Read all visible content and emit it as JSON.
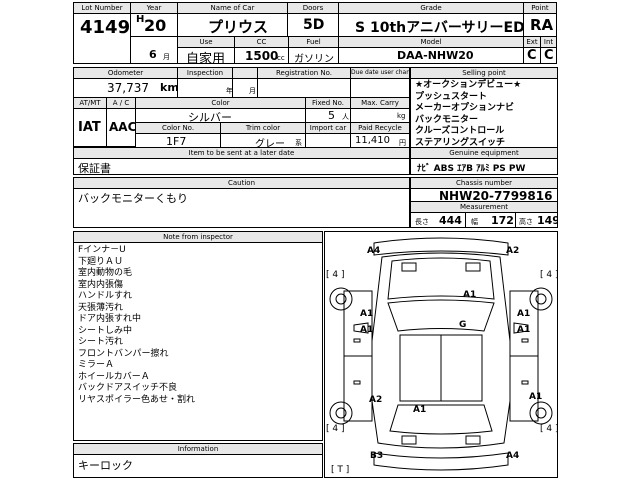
{
  "header": {
    "lot_label": "Lot Number",
    "lot": "4149",
    "year_label": "Year",
    "era": "H",
    "year": "20",
    "name_label": "Name of Car",
    "name": "プリウス",
    "doors_label": "Doors",
    "doors": "5D",
    "grade_label": "Grade",
    "grade": "S 10thアニバーサリーED",
    "point_label": "Point",
    "point": "RA",
    "month": "6",
    "month_unit": "月",
    "use_label": "Use",
    "use": "自家用",
    "cc_label": "CC",
    "cc": "1500",
    "cc_unit": "cc",
    "fuel_label": "Fuel",
    "fuel": "ガソリン",
    "model_label": "Model",
    "model": "DAA-NHW20",
    "ext_label": "Ext",
    "ext": "C",
    "int_label": "Int",
    "int": "C"
  },
  "row2": {
    "odometer_label": "Odometer",
    "odometer": "37,737",
    "odometer_unit": "km",
    "inspection_label": "Inspection",
    "insp_year_unit": "年",
    "insp_month_unit": "月",
    "registration_label": "Registration No.",
    "due_date_label": "Due date user change"
  },
  "row3": {
    "atmt_label": "AT/MT",
    "atmt": "IAT",
    "ac_label": "A / C",
    "ac": "AAC",
    "color_label": "Color",
    "color": "シルバー",
    "fixed_label": "Fixed No.",
    "fixed": "5",
    "fixed_unit": "人",
    "maxcarry_label": "Max. Carry",
    "maxcarry_unit": "kg",
    "colorno_label": "Color No.",
    "colorno": "1F7",
    "trim_label": "Trim color",
    "trim": "グレー",
    "trim_unit": "系",
    "import_label": "Import car",
    "recycle_label": "Paid Recycle",
    "recycle": "11,410",
    "recycle_unit": "円"
  },
  "selling": {
    "label": "Selling point",
    "lines": [
      "★オークションデビュー★",
      "プッシュスタート",
      "メーカーオプションナビ",
      "バックモニター",
      "クルーズコントロール",
      "ステアリングスイッチ"
    ]
  },
  "items_sent": {
    "label": "Item to be sent at a later date",
    "value": "保証書"
  },
  "equipment": {
    "label": "Genuine equipment",
    "value": "ﾅﾋﾞ ABS ｴｱB ｱﾙﾐ PS PW"
  },
  "caution": {
    "label": "Caution",
    "value": "バックモニターくもり"
  },
  "chassis": {
    "label": "Chassis number",
    "value": "NHW20-7799816"
  },
  "measurement": {
    "label": "Measurement",
    "length_label": "長さ",
    "length": "444",
    "width_label": "幅",
    "width": "172",
    "height_label": "高さ",
    "height": "149"
  },
  "notes": {
    "label": "Note from inspector",
    "lines": [
      "Fインナ－U",
      "下廻りＡＵ",
      "室内動物の毛",
      "室内内張傷",
      "ハンドルすれ",
      "天張薄汚れ",
      "ドア内張すれ中",
      "シートしみ中",
      "シート汚れ",
      "フロントバンパー擦れ",
      "ミラーＡ",
      "ホイールカバーＡ",
      "バックドアスイッチ不良",
      "リヤスポイラー色あせ・割れ"
    ]
  },
  "information": {
    "label": "Information",
    "value": "キーロック"
  },
  "diagram": {
    "marks": {
      "a4_tl": "A4",
      "a2_tr": "A2",
      "bracket_l": "[ 4 ]",
      "bracket_r": "[ 4 ]",
      "a1_hood": "A1",
      "a1_left_front": "A1",
      "g_windshield": "G",
      "a1_right_front": "A1",
      "a1_left_mid": "A1",
      "a1_right_mid": "A1",
      "a2_left_rear": "A2",
      "a1_roof_rear": "A1",
      "a1_right_rear": "A1",
      "bracket_bl": "[ 4 ]",
      "bracket_br": "[ 4 ]",
      "b3_bl": "B3",
      "a4_br": "A4",
      "t_mark": "[ T ]"
    }
  }
}
